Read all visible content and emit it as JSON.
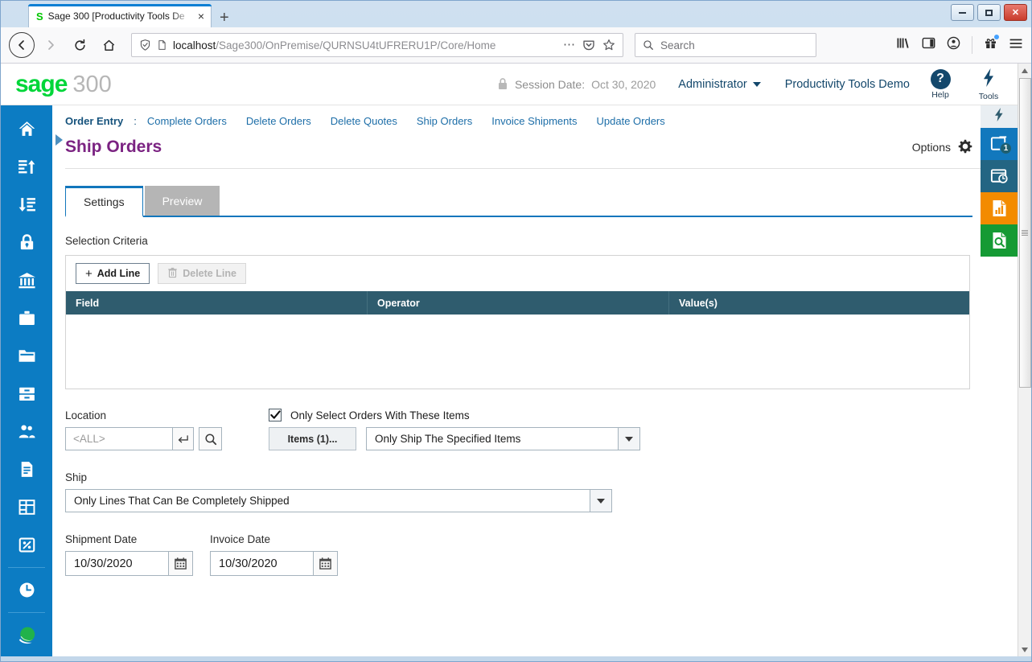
{
  "browser": {
    "tab": {
      "title": "Sage 300 [Productivity Tools De",
      "favicon": "sage-favicon",
      "close_label": "×"
    },
    "new_tab_label": "+",
    "window_controls": {
      "minimize": "minimize-button",
      "maximize": "maximize-button",
      "close": "✕"
    },
    "url": {
      "host": "localhost",
      "path": "/Sage300/OnPremise/QURNSU4tUFRERU1P/Core/Home"
    },
    "search_placeholder": "Search",
    "nav": {
      "back": "back-button",
      "forward": "forward-button",
      "reload": "reload-button",
      "home": "home-button"
    }
  },
  "sage_header": {
    "logo_sage": "sage",
    "logo_number": "300",
    "session_label": "Session Date:",
    "session_date": "Oct 30, 2020",
    "user": "Administrator",
    "company": "Productivity Tools Demo",
    "help_label": "Help",
    "help_glyph": "?",
    "tools_label": "Tools",
    "tools_glyph": "⚡"
  },
  "left_rail": {
    "items": [
      {
        "icon": "home-icon",
        "name": "sidebar-item-home"
      },
      {
        "icon": "accounts-payable-icon",
        "name": "sidebar-item-accounts-payable"
      },
      {
        "icon": "accounts-receivable-icon",
        "name": "sidebar-item-accounts-receivable"
      },
      {
        "icon": "administrative-services-icon",
        "name": "sidebar-item-administrative-services"
      },
      {
        "icon": "bank-services-icon",
        "name": "sidebar-item-bank-services"
      },
      {
        "icon": "common-services-icon",
        "name": "sidebar-item-common-services"
      },
      {
        "icon": "folder-icon",
        "name": "sidebar-item-general-ledger"
      },
      {
        "icon": "inventory-control-icon",
        "name": "sidebar-item-inventory-control"
      },
      {
        "icon": "order-entry-icon",
        "name": "sidebar-item-order-entry"
      },
      {
        "icon": "purchase-orders-icon",
        "name": "sidebar-item-purchase-orders"
      },
      {
        "icon": "grid-icon",
        "name": "sidebar-item-reports"
      },
      {
        "icon": "tax-services-icon",
        "name": "sidebar-item-tax-services"
      },
      {
        "icon": "clock-icon",
        "name": "sidebar-item-recent"
      },
      {
        "icon": "sage-globe-icon",
        "name": "sidebar-item-sage-globe"
      }
    ]
  },
  "breadcrumb": {
    "current": "Order Entry",
    "separator": ":",
    "links": [
      "Complete Orders",
      "Delete Orders",
      "Delete Quotes",
      "Ship Orders",
      "Invoice Shipments",
      "Update Orders"
    ]
  },
  "page": {
    "title": "Ship Orders",
    "options_label": "Options",
    "options_icon": "gear-icon"
  },
  "tabs": [
    {
      "label": "Settings",
      "active": true
    },
    {
      "label": "Preview",
      "active": false
    }
  ],
  "selection_criteria": {
    "section_label": "Selection Criteria",
    "add_line_label": "Add Line",
    "delete_line_label": "Delete Line",
    "delete_line_disabled": true,
    "columns": [
      "Field",
      "Operator",
      "Value(s)"
    ],
    "rows": []
  },
  "location": {
    "label": "Location",
    "value": "<ALL>",
    "go_icon": "enter-arrow-icon",
    "find_icon": "search-icon"
  },
  "items_filter": {
    "checkbox_checked": true,
    "checkbox_label": "Only Select Orders With These Items",
    "items_button_label": "Items (1)...",
    "ship_mode_value": "Only Ship The Specified Items"
  },
  "ship": {
    "label": "Ship",
    "value": "Only Lines That Can Be Completely Shipped"
  },
  "dates": {
    "shipment_label": "Shipment Date",
    "shipment_value": "10/30/2020",
    "invoice_label": "Invoice Date",
    "invoice_value": "10/30/2020",
    "calendar_icon": "calendar-icon"
  },
  "right_rail": {
    "toggle_icon": "bolt-icon",
    "items": [
      {
        "name": "right-rail-window-list",
        "icon": "window-icon",
        "badge": "1",
        "color": "#1278bd"
      },
      {
        "name": "right-rail-schedule",
        "icon": "window-clock-icon",
        "badge": "",
        "color": "#236583"
      },
      {
        "name": "right-rail-reports",
        "icon": "report-chart-icon",
        "badge": "",
        "color": "#f38b00"
      },
      {
        "name": "right-rail-inquiry",
        "icon": "document-search-icon",
        "badge": "",
        "color": "#159a34"
      }
    ]
  },
  "colors": {
    "sage_green": "#00d639",
    "rail_blue": "#0c7cc3",
    "title_purple": "#7b2382",
    "grid_header": "#2f5c6e",
    "link_blue": "#1d6ea8",
    "accent_blue": "#1276bc"
  }
}
